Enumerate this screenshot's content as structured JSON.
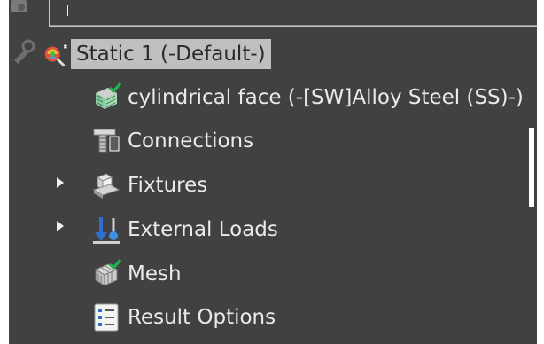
{
  "tree": {
    "study": {
      "label": "Static 1 (-Default-)",
      "icon": "study-icon"
    },
    "items": [
      {
        "label": "cylindrical face (-[SW]Alloy Steel (SS)-)",
        "icon": "part-body-icon"
      },
      {
        "label": "Connections",
        "icon": "connections-icon"
      },
      {
        "label": "Fixtures",
        "icon": "fixtures-icon",
        "expandable": true
      },
      {
        "label": "External Loads",
        "icon": "external-loads-icon",
        "expandable": true
      },
      {
        "label": "Mesh",
        "icon": "mesh-icon"
      },
      {
        "label": "Result Options",
        "icon": "result-options-icon"
      }
    ]
  },
  "colors": {
    "panel_bg": "#414141",
    "text": "#eaeaea",
    "selection_bg": "#bfbfbf",
    "check_green": "#22b14c"
  }
}
